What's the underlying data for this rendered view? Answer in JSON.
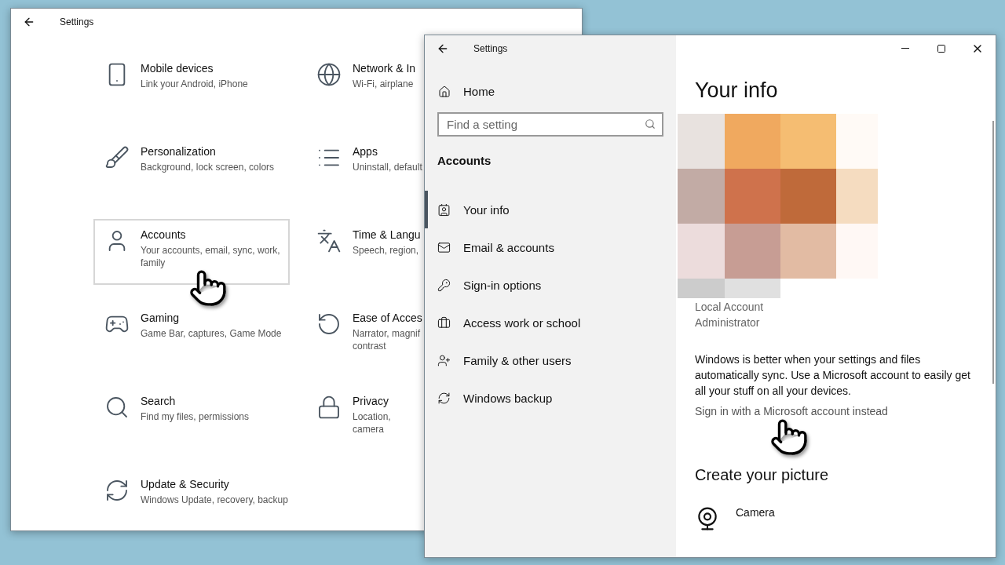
{
  "back_window": {
    "title": "Settings",
    "categories": [
      {
        "title": "Mobile devices",
        "description": "Link your Android, iPhone",
        "selected": false
      },
      {
        "title": "Network & In",
        "description": "Wi-Fi, airplane",
        "selected": false
      },
      {
        "title": "Personalization",
        "description": "Background, lock screen, colors",
        "selected": false
      },
      {
        "title": "Apps",
        "description": "Uninstall, default",
        "selected": false
      },
      {
        "title": "Accounts",
        "description": "Your accounts, email, sync, work, family",
        "selected": true
      },
      {
        "title": "Time & Langu",
        "description": "Speech, region,",
        "selected": false
      },
      {
        "title": "Gaming",
        "description": "Game Bar, captures, Game Mode",
        "selected": false
      },
      {
        "title": "Ease of Acces",
        "description": "Narrator, magnif contrast",
        "selected": false
      },
      {
        "title": "Search",
        "description": "Find my files, permissions",
        "selected": false
      },
      {
        "title": "Privacy",
        "description": "Location, camera",
        "selected": false
      },
      {
        "title": "Update & Security",
        "description": "Windows Update, recovery, backup",
        "selected": false
      }
    ]
  },
  "front_window": {
    "title": "Settings",
    "home": "Home",
    "search": {
      "placeholder": "Find a setting"
    },
    "section": "Accounts",
    "nav": [
      {
        "label": "Your info",
        "selected": true
      },
      {
        "label": "Email & accounts",
        "selected": false
      },
      {
        "label": "Sign-in options",
        "selected": false
      },
      {
        "label": "Access work or school",
        "selected": false
      },
      {
        "label": "Family & other users",
        "selected": false
      },
      {
        "label": "Windows backup",
        "selected": false
      }
    ],
    "heading": "Your info",
    "account_lines": [
      "Local Account",
      "Administrator"
    ],
    "sync_text": "Windows is better when your settings and files automatically sync. Use a Microsoft account to easily get all your stuff on all your devices.",
    "sign_in_link": "Sign in with a Microsoft account instead",
    "create_heading": "Create your picture",
    "options": [
      {
        "label": "Camera"
      }
    ]
  }
}
